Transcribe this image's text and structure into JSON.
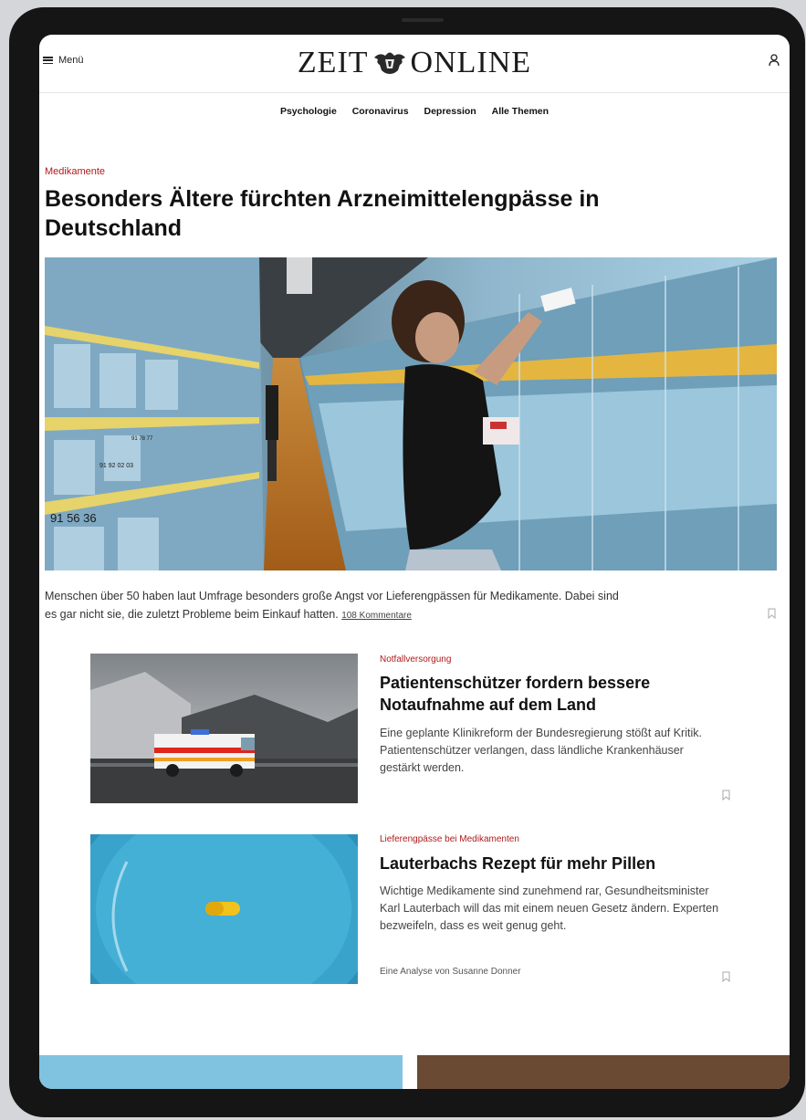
{
  "header": {
    "menu_label": "Menü",
    "logo_left": "ZEIT",
    "logo_right": "ONLINE"
  },
  "nav": {
    "items": [
      "Psychologie",
      "Coronavirus",
      "Depression",
      "Alle Themen"
    ]
  },
  "lead": {
    "kicker": "Medikamente",
    "title": "Besonders Ältere fürchten Arzneimittelengpässe in Deutschland",
    "summary": "Menschen über 50 haben laut Umfrage besonders große Angst vor Lieferengpässen für Medikamente. Dabei sind es gar nicht sie, die zuletzt Probleme beim Einkauf hatten.",
    "comments": "108 Kommentare",
    "image_labels": [
      "91 56 36",
      "91 92 02 03",
      "91 78 77"
    ]
  },
  "teasers": [
    {
      "kicker": "Notfallversorgung",
      "title": "Patientenschützer fordern bessere Notaufnahme auf dem Land",
      "text": "Eine geplante Klinikreform der Bundesregierung stößt auf Kritik. Patientenschützer verlangen, dass ländliche Krankenhäuser gestärkt werden."
    },
    {
      "kicker": "Lieferengpässe bei Medikamenten",
      "title": "Lauterbachs Rezept für mehr Pillen",
      "text": "Wichtige Medikamente sind zunehmend rar, Gesundheitsminister Karl Lauterbach will das mit einem neuen Gesetz ändern. Experten bezweifeln, dass es weit genug geht.",
      "author": "Eine Analyse von Susanne Donner"
    }
  ],
  "colors": {
    "kicker_red": "#b01a1a",
    "text": "#111111",
    "device_frame": "#151515"
  },
  "icons": {
    "menu": "hamburger-icon",
    "account": "user-icon",
    "bookmark": "bookmark-icon"
  }
}
